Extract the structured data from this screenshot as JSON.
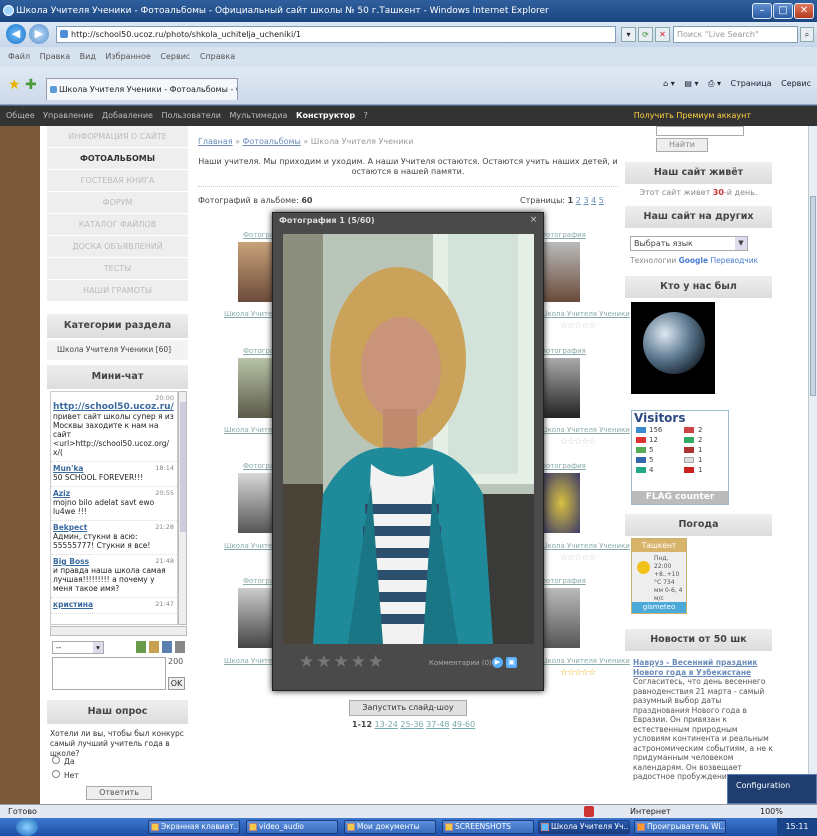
{
  "window": {
    "title": "Школа Учителя Ученики - Фотоальбомы - Официальный сайт школы № 50 г.Ташкент - Windows Internet Explorer"
  },
  "browser": {
    "url": "http://school50.ucoz.ru/photo/shkola_uchitelja_ucheniki/1",
    "search_placeholder": "Поиск \"Live Search\"",
    "menu": [
      "Файл",
      "Правка",
      "Вид",
      "Избранное",
      "Сервис",
      "Справка"
    ],
    "tab_title": "Школа Учителя Ученики - Фотоальбомы - Официа...",
    "cmd": [
      "Страница",
      "Сервис"
    ]
  },
  "sitebar": {
    "items": [
      "Общее",
      "Управление",
      "Добавление",
      "Пользователи",
      "Мультимедиа"
    ],
    "bold": "Конструктор",
    "help": "?",
    "premium": "Получить Премиум аккаунт"
  },
  "left": {
    "menu": [
      "ИНФОРМАЦИЯ О САЙТЕ",
      "ФОТОАЛЬБОМЫ",
      "ГОСТЕВАЯ КНИГА",
      "ФОРУМ",
      "КАТАЛОГ ФАЙЛОВ",
      "ДОСКА ОБЪЯВЛЕНИЙ",
      "ТЕСТЫ",
      "НАШИ ГРАМОТЫ"
    ],
    "categories_title": "Категории раздела",
    "category": "Школа Учителя Ученики [60]",
    "chat_title": "Мини-чат",
    "chat": [
      {
        "user": "http://school50.ucoz.ru/",
        "time": "20:00",
        "text": "привет сайт школы супер я из Москвы заходите к нам на сайт <url>http://school50.ucoz.org/ x/("
      },
      {
        "user": "Mun'ka",
        "time": "18:14",
        "text": "50 SCHOOL FOREVER!!!"
      },
      {
        "user": "Aziz",
        "time": "20:55",
        "text": "mojno bilo adelat savt ewo lu4we !!!"
      },
      {
        "user": "Bekpect",
        "time": "21:28",
        "text": "Админ, стукни в асю: 55555777! Стукни я все!"
      },
      {
        "user": "Big Boss",
        "time": "21:48",
        "text": "и правда наша школа самая лучшая!!!!!!!!! а почему у меня такое имя?"
      },
      {
        "user": "кристина",
        "time": "21:47",
        "text": ""
      }
    ],
    "chat_select": "--",
    "chat_chars": "200",
    "chat_ok": "OK",
    "poll_title": "Наш опрос",
    "poll_question": "Хотели ли вы, чтобы был конкурс самый лучший учитель года в школе?",
    "poll_yes": "Да",
    "poll_no": "Нет",
    "poll_button": "Ответить"
  },
  "center": {
    "breadcrumbs": [
      "Главная",
      "Фотоальбомы",
      "Школа Учителя Ученики"
    ],
    "description": "Наши учителя. Мы приходим и уходим. А наши Учителя остаются. Остаются учить наших детей, и остаются в нашей памяти.",
    "count_label": "Фотографий в альбоме:",
    "count": "60",
    "pages_label": "Страницы:",
    "current_page": "1",
    "pages": [
      "2",
      "3",
      "4",
      "5"
    ],
    "thumb_title": "Фотография",
    "thumb_link": "Школа Учителя Ученики",
    "rating": "☆☆☆☆☆",
    "slideshow": "Запустить слайд-шоу",
    "pager_current": "1-12",
    "pager": [
      "13-24",
      "25-36",
      "37-48",
      "49-60"
    ]
  },
  "right": {
    "login_button": "Найти",
    "lives_title": "Наш сайт живёт",
    "lives_text_pre": "Этот сайт живет",
    "lives_days": "30",
    "lives_text_post": "-й день.",
    "other_title": "Наш сайт на других",
    "lang_select": "Выбрать язык",
    "google_pre": "Технологии",
    "google": "Google",
    "google_post": "Переводчик",
    "who_title": "Кто у нас был",
    "visitors": "Visitors",
    "visitor_rows": [
      {
        "n": "156",
        "m": "2"
      },
      {
        "n": "12",
        "m": "2"
      },
      {
        "n": "5",
        "m": "1"
      },
      {
        "n": "5",
        "m": "1"
      },
      {
        "n": "4",
        "m": "1"
      }
    ],
    "flag_footer": "FLAG counter",
    "weather_title": "Погода",
    "weather_city": "Ташкент",
    "weather_text": "Пнд, 22:00 +8..+10 °C 734 мм 0-6, 4 м/с",
    "weather_footer": "gismeteo",
    "news_title": "Новости от 50 шк",
    "news_link": "Навруз - Весенний праздник Нового года в Узбекистане",
    "news_text": "Согласитесь, что день весеннего равноденствия 21 марта - самый разумный выбор даты празднования Нового года в Евразии. Он привязан к естественным природным условиям континента и реальным астрономическим событиям, а не к придуманным человеком календарям. Он возвещает радостное пробуждение"
  },
  "popup": {
    "title": "Фотография 1 (5/60)",
    "close": "×",
    "comments": "Комментарии (0)"
  },
  "status": {
    "text": "Готово",
    "zone": "Интернет",
    "zoom": "100%"
  },
  "taskbar": {
    "tasks": [
      "Экранная клавиат...",
      "video_audio",
      "Мои документы",
      "SCREENSHOTS",
      "Школа Учителя Уч...",
      "Проигрыватель Wi..."
    ],
    "clock": "15:11",
    "config": "Configuration"
  }
}
